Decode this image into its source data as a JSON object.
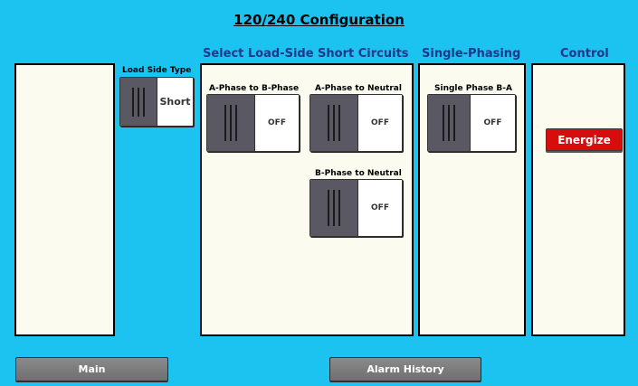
{
  "title": "120/240 Configuration",
  "headers": {
    "short_circuits": "Select Load-Side Short Circuits",
    "single_phasing": "Single-Phasing",
    "control": "Control"
  },
  "load_side": {
    "label": "Load Side Type",
    "state": "Short"
  },
  "switches": {
    "a_to_b": {
      "label": "A-Phase to B-Phase",
      "state": "OFF"
    },
    "a_to_n": {
      "label": "A-Phase to Neutral",
      "state": "OFF"
    },
    "b_to_n": {
      "label": "B-Phase to Neutral",
      "state": "OFF"
    },
    "single_b_a": {
      "label": "Single Phase B-A",
      "state": "OFF"
    }
  },
  "control": {
    "energize": "Energize"
  },
  "nav": {
    "main": "Main",
    "alarm_history": "Alarm History"
  },
  "colors": {
    "background": "#1cc2f0",
    "panel": "#fbfbef",
    "energize": "#d70d0d",
    "header_text": "#1a3a8a"
  }
}
